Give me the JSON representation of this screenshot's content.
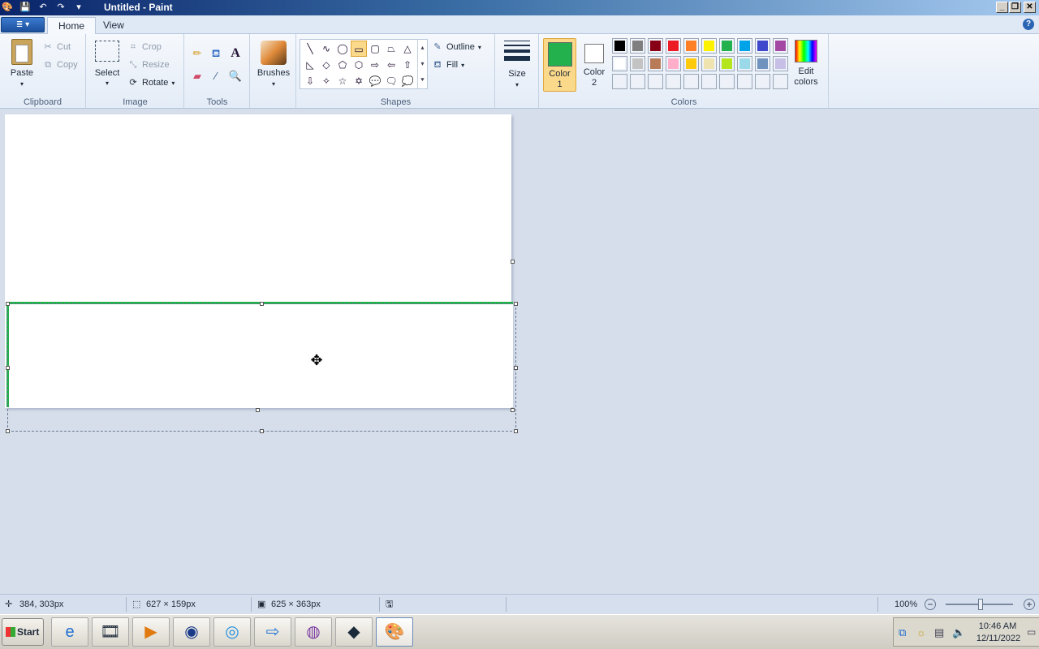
{
  "window": {
    "title": "Untitled - Paint",
    "controls": {
      "minimize": "_",
      "restore": "❐",
      "close": "✕"
    }
  },
  "qat": {
    "paint_icon": "palette-icon",
    "save": "save-icon",
    "undo": "undo-icon",
    "redo": "redo-icon",
    "customize": "▾"
  },
  "ribbon_tabs": {
    "app_menu": "≣ ▾",
    "home": "Home",
    "view": "View",
    "help": "?"
  },
  "clipboard": {
    "label": "Clipboard",
    "paste": "Paste",
    "cut": "Cut",
    "copy": "Copy"
  },
  "image": {
    "label": "Image",
    "select": "Select",
    "crop": "Crop",
    "resize": "Resize",
    "rotate": "Rotate"
  },
  "tools": {
    "label": "Tools"
  },
  "brushes": {
    "label": "Brushes"
  },
  "shapes": {
    "label": "Shapes",
    "outline": "Outline",
    "fill": "Fill",
    "items": [
      "╲",
      "∿",
      "◯",
      "▭",
      "▢",
      "⏢",
      "△",
      "◺",
      "◇",
      "⬠",
      "⬡",
      "⇨",
      "⇦",
      "⇧",
      "⇩",
      "✧",
      "☆",
      "✡",
      "💬",
      "🗨",
      "💭"
    ]
  },
  "size": {
    "label": "Size"
  },
  "colors": {
    "label": "Colors",
    "color1_label_a": "Color",
    "color1_label_b": "1",
    "color2_label_a": "Color",
    "color2_label_b": "2",
    "color1": "#22b14c",
    "color2": "#ffffff",
    "edit": "Edit colors",
    "palette_row1": [
      "#000000",
      "#7f7f7f",
      "#880015",
      "#ed1c24",
      "#ff7f27",
      "#fff200",
      "#22b14c",
      "#00a2e8",
      "#3f48cc",
      "#a349a4"
    ],
    "palette_row2": [
      "#ffffff",
      "#c3c3c3",
      "#b97a57",
      "#ffaec9",
      "#ffc90e",
      "#efe4b0",
      "#b5e61d",
      "#99d9ea",
      "#7092be",
      "#c8bfe7"
    ]
  },
  "status": {
    "cursor_pos": "384, 303px",
    "selection_size": "627 × 159px",
    "image_size": "625 × 363px",
    "zoom": "100%"
  },
  "taskbar": {
    "start": "Start",
    "time": "10:46 AM",
    "date": "12/11/2022"
  }
}
